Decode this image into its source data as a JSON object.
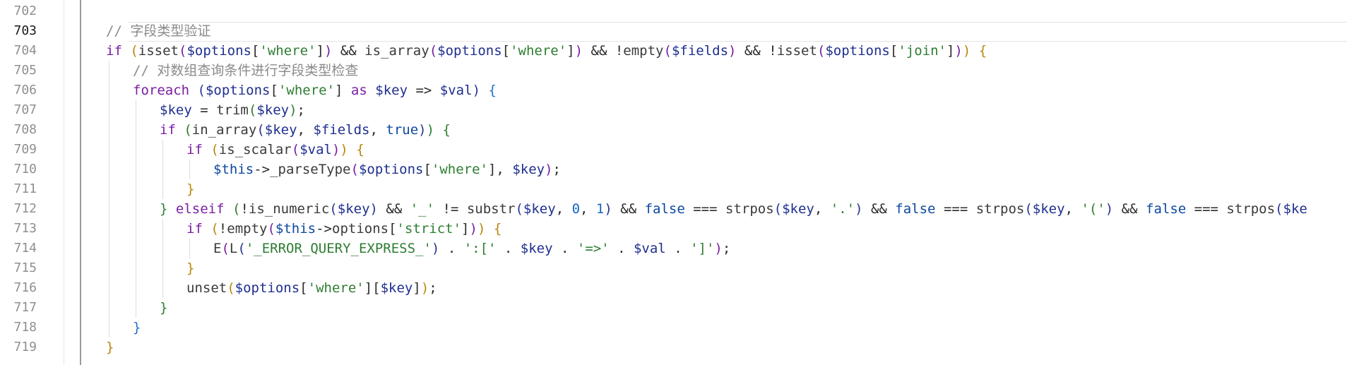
{
  "editor": {
    "language": "php",
    "colors": {
      "comment": "#8a8a8a",
      "keyword": "#7a1fa2",
      "variable": "#1f2f8f",
      "string": "#2e7d32",
      "number": "#1565c0",
      "line_number": "#8f8f8f",
      "active_line_number": "#1a1a1a"
    },
    "line_numbers": [
      "702",
      "703",
      "704",
      "705",
      "706",
      "707",
      "708",
      "709",
      "710",
      "711",
      "712",
      "713",
      "714",
      "715",
      "716",
      "717",
      "718",
      "719"
    ],
    "active_line": "703",
    "top_fragment": "...",
    "lines": [
      {
        "n": "702",
        "indent": 0,
        "tokens": []
      },
      {
        "n": "703",
        "indent": 1,
        "tokens": [
          {
            "c": "t-comment",
            "t": "// 字段类型验证"
          }
        ]
      },
      {
        "n": "704",
        "indent": 1,
        "tokens": [
          {
            "c": "t-kw",
            "t": "if"
          },
          {
            "c": "t-op",
            "t": " "
          },
          {
            "c": "t-brace-y",
            "t": "("
          },
          {
            "c": "t-fn",
            "t": "isset"
          },
          {
            "c": "t-brace-p",
            "t": "("
          },
          {
            "c": "t-var",
            "t": "$options"
          },
          {
            "c": "t-op",
            "t": "["
          },
          {
            "c": "t-str",
            "t": "'where'"
          },
          {
            "c": "t-op",
            "t": "]"
          },
          {
            "c": "t-brace-p",
            "t": ")"
          },
          {
            "c": "t-op",
            "t": " && "
          },
          {
            "c": "t-fn",
            "t": "is_array"
          },
          {
            "c": "t-brace-p",
            "t": "("
          },
          {
            "c": "t-var",
            "t": "$options"
          },
          {
            "c": "t-op",
            "t": "["
          },
          {
            "c": "t-str",
            "t": "'where'"
          },
          {
            "c": "t-op",
            "t": "]"
          },
          {
            "c": "t-brace-p",
            "t": ")"
          },
          {
            "c": "t-op",
            "t": " && !"
          },
          {
            "c": "t-fn",
            "t": "empty"
          },
          {
            "c": "t-brace-p",
            "t": "("
          },
          {
            "c": "t-var",
            "t": "$fields"
          },
          {
            "c": "t-brace-p",
            "t": ")"
          },
          {
            "c": "t-op",
            "t": " && !"
          },
          {
            "c": "t-fn",
            "t": "isset"
          },
          {
            "c": "t-brace-p",
            "t": "("
          },
          {
            "c": "t-var",
            "t": "$options"
          },
          {
            "c": "t-op",
            "t": "["
          },
          {
            "c": "t-str",
            "t": "'join'"
          },
          {
            "c": "t-op",
            "t": "]"
          },
          {
            "c": "t-brace-p",
            "t": ")"
          },
          {
            "c": "t-brace-y",
            "t": ")"
          },
          {
            "c": "t-op",
            "t": " "
          },
          {
            "c": "t-brace-y",
            "t": "{"
          }
        ]
      },
      {
        "n": "705",
        "indent": 2,
        "tokens": [
          {
            "c": "t-comment",
            "t": "// 对数组查询条件进行字段类型检查"
          }
        ]
      },
      {
        "n": "706",
        "indent": 2,
        "tokens": [
          {
            "c": "t-kw",
            "t": "foreach"
          },
          {
            "c": "t-op",
            "t": " "
          },
          {
            "c": "t-brace-b",
            "t": "("
          },
          {
            "c": "t-var",
            "t": "$options"
          },
          {
            "c": "t-op",
            "t": "["
          },
          {
            "c": "t-str",
            "t": "'where'"
          },
          {
            "c": "t-op",
            "t": "] "
          },
          {
            "c": "t-kw",
            "t": "as"
          },
          {
            "c": "t-op",
            "t": " "
          },
          {
            "c": "t-var",
            "t": "$key"
          },
          {
            "c": "t-op",
            "t": " => "
          },
          {
            "c": "t-var",
            "t": "$val"
          },
          {
            "c": "t-brace-b",
            "t": ")"
          },
          {
            "c": "t-op",
            "t": " "
          },
          {
            "c": "t-brace",
            "t": "{"
          }
        ]
      },
      {
        "n": "707",
        "indent": 3,
        "tokens": [
          {
            "c": "t-var",
            "t": "$key"
          },
          {
            "c": "t-op",
            "t": " = "
          },
          {
            "c": "t-fn",
            "t": "trim"
          },
          {
            "c": "t-brace-g",
            "t": "("
          },
          {
            "c": "t-var",
            "t": "$key"
          },
          {
            "c": "t-brace-g",
            "t": ")"
          },
          {
            "c": "t-op",
            "t": ";"
          }
        ]
      },
      {
        "n": "708",
        "indent": 3,
        "tokens": [
          {
            "c": "t-kw",
            "t": "if"
          },
          {
            "c": "t-op",
            "t": " "
          },
          {
            "c": "t-brace-g",
            "t": "("
          },
          {
            "c": "t-fn",
            "t": "in_array"
          },
          {
            "c": "t-brace-b",
            "t": "("
          },
          {
            "c": "t-var",
            "t": "$key"
          },
          {
            "c": "t-op",
            "t": ", "
          },
          {
            "c": "t-var",
            "t": "$fields"
          },
          {
            "c": "t-op",
            "t": ", "
          },
          {
            "c": "t-const",
            "t": "true"
          },
          {
            "c": "t-brace-b",
            "t": ")"
          },
          {
            "c": "t-brace-g",
            "t": ")"
          },
          {
            "c": "t-op",
            "t": " "
          },
          {
            "c": "t-brace-g",
            "t": "{"
          }
        ]
      },
      {
        "n": "709",
        "indent": 4,
        "tokens": [
          {
            "c": "t-kw",
            "t": "if"
          },
          {
            "c": "t-op",
            "t": " "
          },
          {
            "c": "t-brace-y",
            "t": "("
          },
          {
            "c": "t-fn",
            "t": "is_scalar"
          },
          {
            "c": "t-brace-p",
            "t": "("
          },
          {
            "c": "t-var",
            "t": "$val"
          },
          {
            "c": "t-brace-p",
            "t": ")"
          },
          {
            "c": "t-brace-y",
            "t": ")"
          },
          {
            "c": "t-op",
            "t": " "
          },
          {
            "c": "t-brace-y",
            "t": "{"
          }
        ]
      },
      {
        "n": "710",
        "indent": 5,
        "tokens": [
          {
            "c": "t-const",
            "t": "$this"
          },
          {
            "c": "t-op",
            "t": "->"
          },
          {
            "c": "t-fn",
            "t": "_parseType"
          },
          {
            "c": "t-brace-p",
            "t": "("
          },
          {
            "c": "t-var",
            "t": "$options"
          },
          {
            "c": "t-op",
            "t": "["
          },
          {
            "c": "t-str",
            "t": "'where'"
          },
          {
            "c": "t-op",
            "t": "], "
          },
          {
            "c": "t-var",
            "t": "$key"
          },
          {
            "c": "t-brace-p",
            "t": ")"
          },
          {
            "c": "t-op",
            "t": ";"
          }
        ]
      },
      {
        "n": "711",
        "indent": 4,
        "tokens": [
          {
            "c": "t-brace-y",
            "t": "}"
          }
        ]
      },
      {
        "n": "712",
        "indent": 3,
        "tokens": [
          {
            "c": "t-brace-g",
            "t": "}"
          },
          {
            "c": "t-op",
            "t": " "
          },
          {
            "c": "t-kw",
            "t": "elseif"
          },
          {
            "c": "t-op",
            "t": " "
          },
          {
            "c": "t-brace-g",
            "t": "("
          },
          {
            "c": "t-op",
            "t": "!"
          },
          {
            "c": "t-fn",
            "t": "is_numeric"
          },
          {
            "c": "t-brace-b",
            "t": "("
          },
          {
            "c": "t-var",
            "t": "$key"
          },
          {
            "c": "t-brace-b",
            "t": ")"
          },
          {
            "c": "t-op",
            "t": " && "
          },
          {
            "c": "t-str",
            "t": "'_'"
          },
          {
            "c": "t-op",
            "t": " != "
          },
          {
            "c": "t-fn",
            "t": "substr"
          },
          {
            "c": "t-brace-b",
            "t": "("
          },
          {
            "c": "t-var",
            "t": "$key"
          },
          {
            "c": "t-op",
            "t": ", "
          },
          {
            "c": "t-num",
            "t": "0"
          },
          {
            "c": "t-op",
            "t": ", "
          },
          {
            "c": "t-num",
            "t": "1"
          },
          {
            "c": "t-brace-b",
            "t": ")"
          },
          {
            "c": "t-op",
            "t": " && "
          },
          {
            "c": "t-const",
            "t": "false"
          },
          {
            "c": "t-op",
            "t": " === "
          },
          {
            "c": "t-fn",
            "t": "strpos"
          },
          {
            "c": "t-brace-b",
            "t": "("
          },
          {
            "c": "t-var",
            "t": "$key"
          },
          {
            "c": "t-op",
            "t": ", "
          },
          {
            "c": "t-str",
            "t": "'.'"
          },
          {
            "c": "t-brace-b",
            "t": ")"
          },
          {
            "c": "t-op",
            "t": " && "
          },
          {
            "c": "t-const",
            "t": "false"
          },
          {
            "c": "t-op",
            "t": " === "
          },
          {
            "c": "t-fn",
            "t": "strpos"
          },
          {
            "c": "t-brace-b",
            "t": "("
          },
          {
            "c": "t-var",
            "t": "$key"
          },
          {
            "c": "t-op",
            "t": ", "
          },
          {
            "c": "t-str",
            "t": "'('"
          },
          {
            "c": "t-brace-b",
            "t": ")"
          },
          {
            "c": "t-op",
            "t": " && "
          },
          {
            "c": "t-const",
            "t": "false"
          },
          {
            "c": "t-op",
            "t": " === "
          },
          {
            "c": "t-fn",
            "t": "strpos"
          },
          {
            "c": "t-brace-b",
            "t": "("
          },
          {
            "c": "t-var",
            "t": "$ke"
          }
        ]
      },
      {
        "n": "713",
        "indent": 4,
        "tokens": [
          {
            "c": "t-kw",
            "t": "if"
          },
          {
            "c": "t-op",
            "t": " "
          },
          {
            "c": "t-brace-y",
            "t": "("
          },
          {
            "c": "t-op",
            "t": "!"
          },
          {
            "c": "t-fn",
            "t": "empty"
          },
          {
            "c": "t-brace-p",
            "t": "("
          },
          {
            "c": "t-const",
            "t": "$this"
          },
          {
            "c": "t-op",
            "t": "->"
          },
          {
            "c": "t-fn",
            "t": "options"
          },
          {
            "c": "t-op",
            "t": "["
          },
          {
            "c": "t-str",
            "t": "'strict'"
          },
          {
            "c": "t-op",
            "t": "]"
          },
          {
            "c": "t-brace-p",
            "t": ")"
          },
          {
            "c": "t-brace-y",
            "t": ")"
          },
          {
            "c": "t-op",
            "t": " "
          },
          {
            "c": "t-brace-y",
            "t": "{"
          }
        ]
      },
      {
        "n": "714",
        "indent": 5,
        "tokens": [
          {
            "c": "t-fn",
            "t": "E"
          },
          {
            "c": "t-brace-p",
            "t": "("
          },
          {
            "c": "t-fn",
            "t": "L"
          },
          {
            "c": "t-brace-b",
            "t": "("
          },
          {
            "c": "t-str",
            "t": "'_ERROR_QUERY_EXPRESS_'"
          },
          {
            "c": "t-brace-b",
            "t": ")"
          },
          {
            "c": "t-op",
            "t": " . "
          },
          {
            "c": "t-str",
            "t": "':['"
          },
          {
            "c": "t-op",
            "t": " . "
          },
          {
            "c": "t-var",
            "t": "$key"
          },
          {
            "c": "t-op",
            "t": " . "
          },
          {
            "c": "t-str",
            "t": "'=>'"
          },
          {
            "c": "t-op",
            "t": " . "
          },
          {
            "c": "t-var",
            "t": "$val"
          },
          {
            "c": "t-op",
            "t": " . "
          },
          {
            "c": "t-str",
            "t": "']'"
          },
          {
            "c": "t-brace-p",
            "t": ")"
          },
          {
            "c": "t-op",
            "t": ";"
          }
        ]
      },
      {
        "n": "715",
        "indent": 4,
        "tokens": [
          {
            "c": "t-brace-y",
            "t": "}"
          }
        ]
      },
      {
        "n": "716",
        "indent": 4,
        "tokens": [
          {
            "c": "t-fn",
            "t": "unset"
          },
          {
            "c": "t-brace-y",
            "t": "("
          },
          {
            "c": "t-var",
            "t": "$options"
          },
          {
            "c": "t-op",
            "t": "["
          },
          {
            "c": "t-str",
            "t": "'where'"
          },
          {
            "c": "t-op",
            "t": "]["
          },
          {
            "c": "t-var",
            "t": "$key"
          },
          {
            "c": "t-op",
            "t": "]"
          },
          {
            "c": "t-brace-y",
            "t": ")"
          },
          {
            "c": "t-op",
            "t": ";"
          }
        ]
      },
      {
        "n": "717",
        "indent": 3,
        "tokens": [
          {
            "c": "t-brace-g",
            "t": "}"
          }
        ]
      },
      {
        "n": "718",
        "indent": 2,
        "tokens": [
          {
            "c": "t-brace",
            "t": "}"
          }
        ]
      },
      {
        "n": "719",
        "indent": 1,
        "tokens": [
          {
            "c": "t-brace-y",
            "t": "}"
          }
        ]
      }
    ]
  }
}
